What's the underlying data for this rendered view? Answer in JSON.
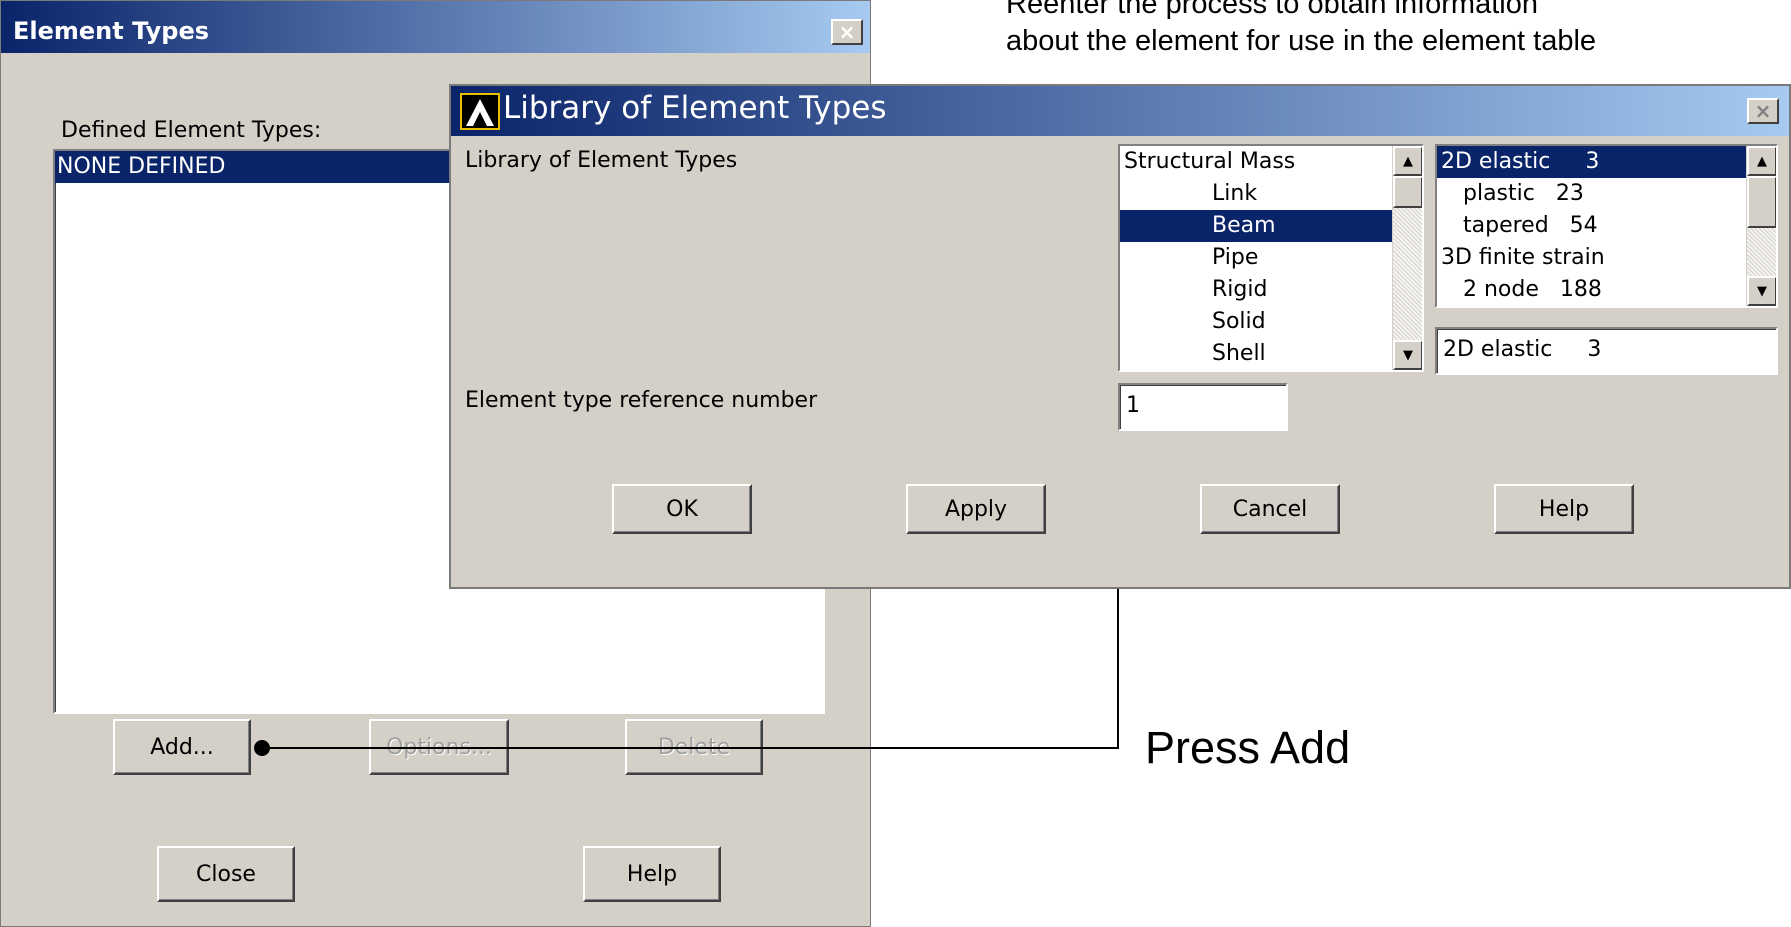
{
  "annotations": {
    "top_line1": "Reenter the process to obtain information",
    "top_line2": "about the element for use in the element table",
    "press": "Press Add"
  },
  "element_types_window": {
    "title": "Element Types",
    "close_glyph": "×",
    "defined_label": "Defined Element Types:",
    "defined_items": [
      "NONE DEFINED"
    ],
    "buttons": {
      "add": "Add...",
      "options": "Options...",
      "delete": "Delete",
      "close": "Close",
      "help": "Help"
    }
  },
  "library_window": {
    "title": "Library of Element Types",
    "logo_glyph": "Λ",
    "close_glyph": "×",
    "library_label": "Library of Element Types",
    "ref_label": "Element type reference number",
    "categories": [
      "Structural Mass",
      "Link",
      "Beam",
      "Pipe",
      "Rigid",
      "Solid",
      "Shell"
    ],
    "selected_category": "Beam",
    "types": [
      "2D elastic     3",
      "plastic   23",
      "tapered   54",
      "3D finite strain",
      "2 node   188"
    ],
    "selected_type": "2D elastic     3",
    "type_field_value": "2D elastic     3",
    "ref_value": "1",
    "buttons": {
      "ok": "OK",
      "apply": "Apply",
      "cancel": "Cancel",
      "help": "Help"
    }
  },
  "icons": {
    "scroll_up": "up-arrow-icon",
    "scroll_down": "down-arrow-icon",
    "close": "close-icon",
    "logo": "ansys-logo-icon"
  },
  "colors": {
    "title_start": "#0a246a",
    "title_end": "#a6caf0",
    "selection": "#0a246a",
    "dialog_bg": "#d4d0c8"
  }
}
